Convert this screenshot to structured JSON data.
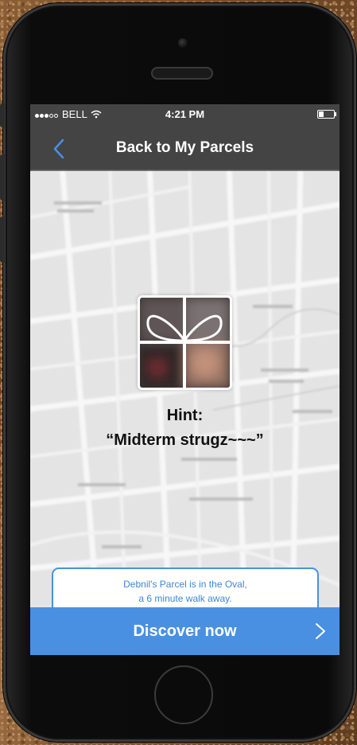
{
  "status_bar": {
    "carrier": "BELL",
    "signal_bars_filled": 3,
    "signal_bars_total": 5,
    "time": "4:21 PM"
  },
  "nav": {
    "back_icon": "chevron-left-icon",
    "title": "Back to My Parcels"
  },
  "parcel": {
    "icon": "gift-icon",
    "hint_label": "Hint:",
    "hint_text": "“Midterm strugz~~~”"
  },
  "location_card": {
    "line1": "Debnil's Parcel is in the Oval,",
    "line2": "a 6 minute walk away."
  },
  "action": {
    "label": "Discover now",
    "chevron_icon": "chevron-right-icon"
  },
  "colors": {
    "accent": "#4a90e2",
    "nav_bg": "#444444",
    "card_text": "#3b86d8"
  }
}
